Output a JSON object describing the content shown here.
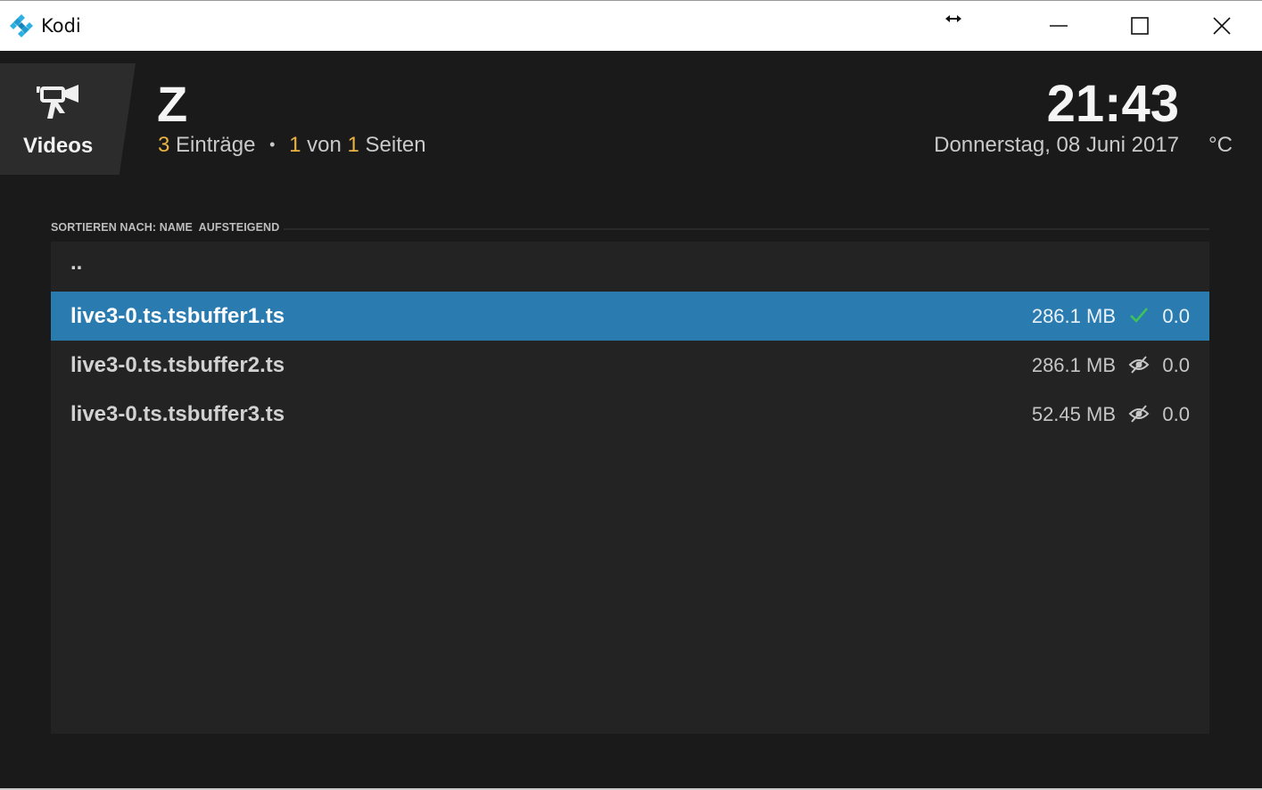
{
  "window": {
    "title": "Kodi",
    "controls": [
      "minimize",
      "maximize",
      "close"
    ]
  },
  "header": {
    "section_label": "Videos",
    "section_icon": "video-camera-icon",
    "folder_title": "Z",
    "entry_count": "3",
    "entries_label": "Einträge",
    "page_current": "1",
    "page_of_label": "von",
    "page_total": "1",
    "pages_label": "Seiten",
    "separator": "•",
    "time": "21:43",
    "date": "Donnerstag, 08 Juni 2017",
    "weather_unit": "°C"
  },
  "sort": {
    "label": "SORTIEREN NACH: NAME  AUFSTEIGEND"
  },
  "list": {
    "parent": "..",
    "items": [
      {
        "name": "live3-0.ts.tsbuffer1.ts",
        "size": "286.1 MB",
        "status_icon": "checkmark-icon",
        "rating": "0.0",
        "selected": true
      },
      {
        "name": "live3-0.ts.tsbuffer2.ts",
        "size": "286.1 MB",
        "status_icon": "unwatched-eye-icon",
        "rating": "0.0",
        "selected": false
      },
      {
        "name": "live3-0.ts.tsbuffer3.ts",
        "size": "52.45 MB",
        "status_icon": "unwatched-eye-icon",
        "rating": "0.0",
        "selected": false
      }
    ]
  },
  "colors": {
    "accent_selection": "#2a7bb0",
    "highlight_number": "#e9b244",
    "watched_check": "#3ec35a",
    "background": "#1a1a1a",
    "panel": "#232323"
  }
}
